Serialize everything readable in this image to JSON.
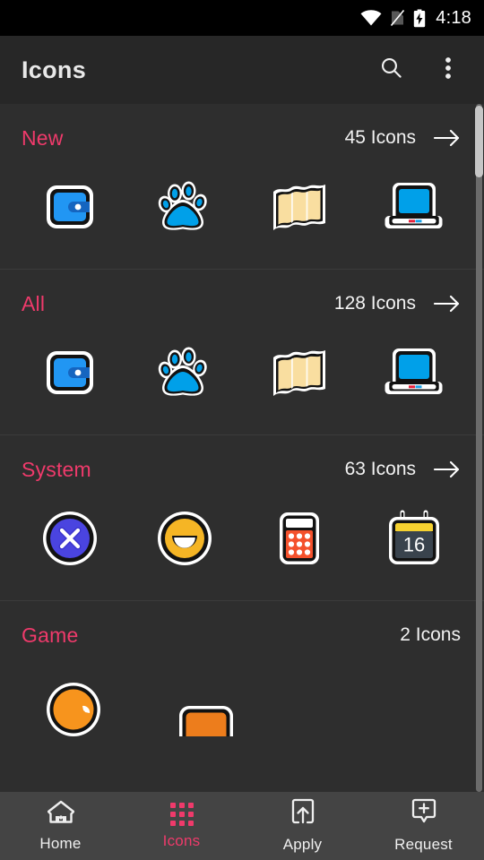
{
  "theme": {
    "accent": "#ef3a6b",
    "background": "#2e2e2e",
    "toolbar_bg": "#272727",
    "statusbar_bg": "#000000",
    "bottomnav_bg": "#444444",
    "text_primary": "#f2f2f2"
  },
  "statusbar": {
    "time": "4:18",
    "icons": [
      "wifi-icon",
      "sim-off-icon",
      "battery-charging-icon"
    ]
  },
  "toolbar": {
    "title": "Icons",
    "search_label": "search-icon",
    "overflow_label": "more-options-icon"
  },
  "sections": [
    {
      "title": "New",
      "count": "45 Icons",
      "has_arrow": true,
      "icons": [
        "wallet-icon",
        "paw-icon",
        "map-icon",
        "laptop-icon"
      ]
    },
    {
      "title": "All",
      "count": "128 Icons",
      "has_arrow": true,
      "icons": [
        "wallet-icon",
        "paw-icon",
        "map-icon",
        "laptop-icon"
      ]
    },
    {
      "title": "System",
      "count": "63 Icons",
      "has_arrow": true,
      "icons": [
        "close-circle-icon",
        "smiley-icon",
        "calculator-icon",
        "calendar-icon"
      ]
    },
    {
      "title": "Game",
      "count": "2 Icons",
      "has_arrow": false,
      "icons": [
        "game-orange-round-icon",
        "game-orange-card-icon"
      ]
    }
  ],
  "bottom_nav": [
    {
      "label": "Home",
      "icon": "home-icon",
      "active": false
    },
    {
      "label": "Icons",
      "icon": "grid-icon",
      "active": true
    },
    {
      "label": "Apply",
      "icon": "apply-icon",
      "active": false
    },
    {
      "label": "Request",
      "icon": "request-icon",
      "active": false
    }
  ],
  "calendar_icon_day": "16"
}
